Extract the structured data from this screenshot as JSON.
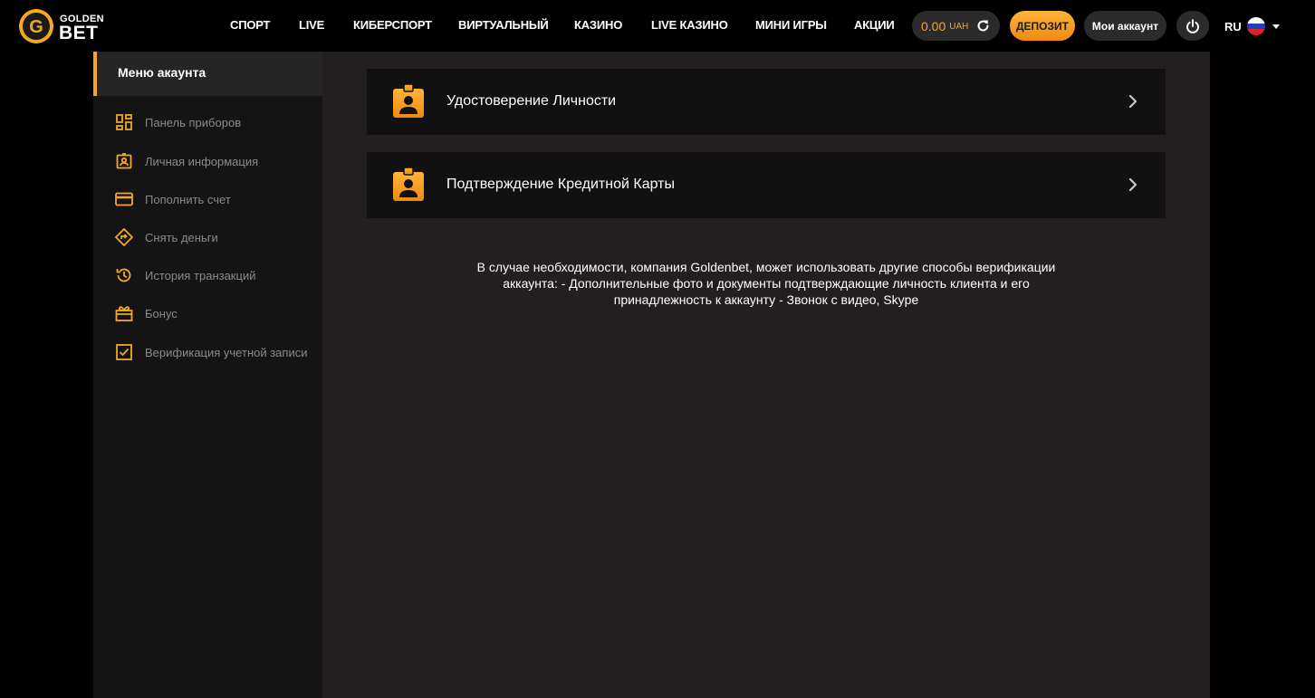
{
  "header": {
    "logo": {
      "top_text": "GOLDEN",
      "bottom_text": "BET",
      "letter": "G"
    },
    "nav": [
      {
        "label": "СПОРТ"
      },
      {
        "label": "LIVE"
      },
      {
        "label": "КИБЕРСПОРТ"
      },
      {
        "label": "ВИРТУАЛЬНЫЙ"
      },
      {
        "label": "КАЗИНО"
      },
      {
        "label": "LIVE КАЗИНО"
      },
      {
        "label": "МИНИ ИГРЫ"
      },
      {
        "label": "АКЦИИ"
      }
    ],
    "balance": {
      "amount": "0.00",
      "currency": "UAH"
    },
    "deposit_label": "ДЕПОЗИТ",
    "account_label": "Мои аккаунт",
    "language": {
      "code": "RU"
    }
  },
  "sidebar": {
    "title": "Меню акаунта",
    "items": [
      {
        "label": "Панель приборов",
        "icon": "dashboard-icon"
      },
      {
        "label": "Личная информация",
        "icon": "id-card-icon"
      },
      {
        "label": "Пополнить счет",
        "icon": "credit-card-icon"
      },
      {
        "label": "Снять деньги",
        "icon": "withdraw-icon"
      },
      {
        "label": "История транзакций",
        "icon": "history-icon"
      },
      {
        "label": "Бонус",
        "icon": "gift-icon"
      },
      {
        "label": "Верификация учетной записи",
        "icon": "checkbox-icon"
      }
    ]
  },
  "main": {
    "cards": [
      {
        "label": "Удостоверение Личности",
        "icon": "badge-user-icon"
      },
      {
        "label": "Подтверждение Кредитной Карты",
        "icon": "badge-user-icon"
      }
    ],
    "info_lines": [
      "В случае необходимости, компания Goldenbet, может использовать другие способы верификации",
      "аккаунта: - Дополнительные фото и документы подтверждающие личность клиента и его",
      "принадлежность к аккаунту - Звонок с видео, Skype"
    ]
  },
  "colors": {
    "accent": "#f5a623",
    "sidebar_bg": "#141414",
    "main_bg": "#231f20",
    "card_bg": "#111111"
  }
}
